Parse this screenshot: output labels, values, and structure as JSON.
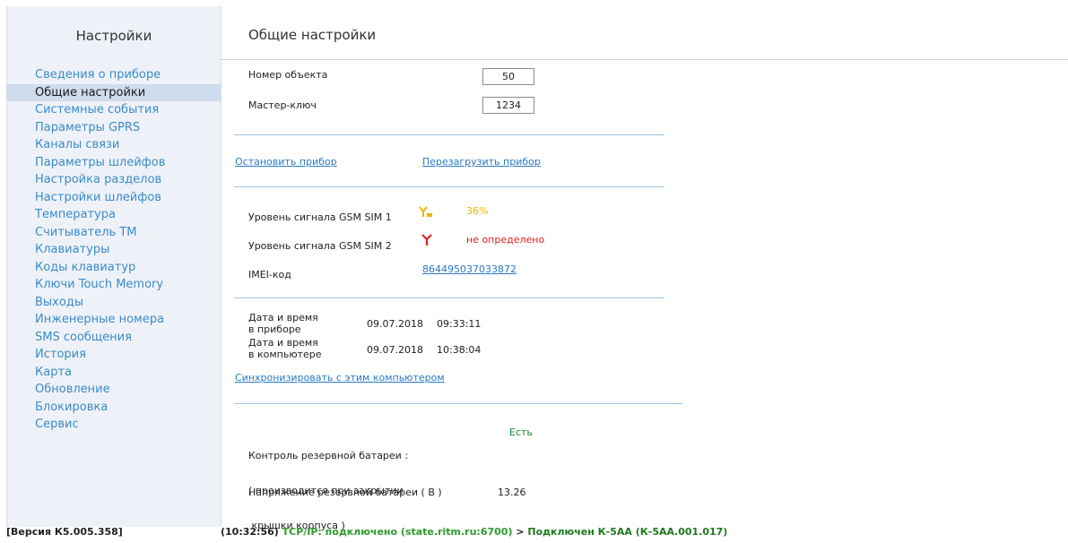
{
  "sidebar": {
    "title": "Настройки",
    "items": [
      {
        "label": "Сведения о приборе"
      },
      {
        "label": "Общие настройки"
      },
      {
        "label": "Системные события"
      },
      {
        "label": "Параметры GPRS"
      },
      {
        "label": "Каналы связи"
      },
      {
        "label": "Параметры шлейфов"
      },
      {
        "label": "Настройка разделов"
      },
      {
        "label": "Настройки шлейфов"
      },
      {
        "label": "Температура"
      },
      {
        "label": "Считыватель ТМ"
      },
      {
        "label": "Клавиатуры"
      },
      {
        "label": "Коды клавиатур"
      },
      {
        "label": "Ключи Touch Memory"
      },
      {
        "label": "Выходы"
      },
      {
        "label": "Инженерные номера"
      },
      {
        "label": "SMS сообщения"
      },
      {
        "label": "История"
      },
      {
        "label": "Карта"
      },
      {
        "label": "Обновление"
      },
      {
        "label": "Блокировка"
      },
      {
        "label": "Сервис"
      }
    ],
    "active_index": 1
  },
  "main": {
    "title": "Общие настройки",
    "object_number": {
      "label": "Номер объекта",
      "value": "50"
    },
    "master_key": {
      "label": "Мастер-ключ",
      "value": "1234"
    },
    "stop_link": "Остановить прибор",
    "restart_link": "Перезагрузить прибор",
    "gsm1": {
      "label": "Уровень сигнала GSM SIM 1",
      "value": "36%",
      "icon": "signal-low-icon",
      "color": "#f0b400"
    },
    "gsm2": {
      "label": "Уровень сигнала GSM SIM 2",
      "value": "не определено",
      "icon": "antenna-icon",
      "color": "#e02020"
    },
    "imei": {
      "label": "IMEI-код",
      "value": "864495037033872"
    },
    "device_time": {
      "label_line1": "Дата и время",
      "label_line2": "в приборе",
      "date": "09.07.2018",
      "time": "09:33:11"
    },
    "pc_time": {
      "label_line1": "Дата и время",
      "label_line2": "в компьютере",
      "date": "09.07.2018",
      "time": "10:38:04"
    },
    "sync_link": "Синхронизировать с этим компьютером",
    "battery_control": {
      "label_line1": "Контроль резервной батареи :",
      "label_line2": "( производится при закрытии",
      "label_line3": " крышки корпуса )",
      "value": "Есть",
      "color": "#1e8a3a"
    },
    "battery_voltage": {
      "label": "Напряжение резервной батареи ( В )",
      "value": "13.26"
    }
  },
  "status": {
    "version": "[Версия К5.005.358]",
    "time": "(10:32:56)",
    "connection": "TCP/IP: подключено (state.ritm.ru:6700)",
    "arrow": ">",
    "device": "Подключен К-5АА (К-5АА.001.017)"
  }
}
